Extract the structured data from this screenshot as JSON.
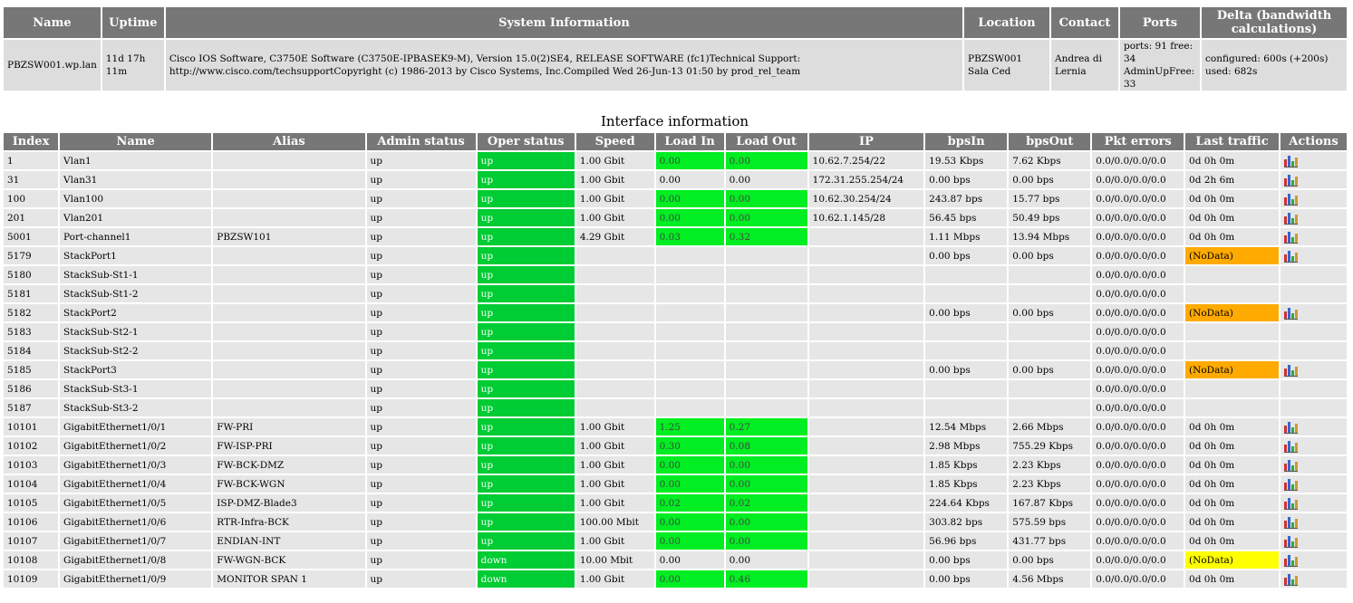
{
  "system": {
    "headers": [
      "Name",
      "Uptime",
      "System Information",
      "Location",
      "Contact",
      "Ports",
      "Delta (bandwidth calculations)"
    ],
    "name": "PBZSW001.wp.lan",
    "uptime": "11d 17h 11m",
    "info": "Cisco IOS Software, C3750E Software (C3750E-IPBASEK9-M), Version 15.0(2)SE4, RELEASE SOFTWARE (fc1)Technical Support: http://www.cisco.com/techsupportCopyright (c) 1986-2013 by Cisco Systems, Inc.Compiled Wed 26-Jun-13 01:50 by prod_rel_team",
    "location": "PBZSW001 Sala Ced",
    "contact": "Andrea di Lernia",
    "ports": "ports: 91 free: 34 AdminUpFree: 33",
    "delta": "configured: 600s (+200s) used: 682s"
  },
  "interfaces": {
    "title": "Interface information",
    "headers": [
      "Index",
      "Name",
      "Alias",
      "Admin status",
      "Oper status",
      "Speed",
      "Load In",
      "Load Out",
      "IP",
      "bpsIn",
      "bpsOut",
      "Pkt errors",
      "Last traffic",
      "Actions"
    ],
    "rows": [
      {
        "index": "1",
        "name": "Vlan1",
        "alias": "",
        "admin": "up",
        "oper": "up",
        "speed": "1.00 Gbit",
        "load_in": "0.00",
        "load_out": "0.00",
        "ip": "10.62.7.254/22",
        "bps_in": "19.53 Kbps",
        "bps_out": "7.62 Kbps",
        "errors": "0.0/0.0/0.0/0.0",
        "last": "0d 0h 0m",
        "last_status": "",
        "load_hl": true,
        "action": true
      },
      {
        "index": "31",
        "name": "Vlan31",
        "alias": "",
        "admin": "up",
        "oper": "up",
        "speed": "1.00 Gbit",
        "load_in": "0.00",
        "load_out": "0.00",
        "ip": "172.31.255.254/24",
        "bps_in": "0.00 bps",
        "bps_out": "0.00 bps",
        "errors": "0.0/0.0/0.0/0.0",
        "last": "0d 2h 6m",
        "last_status": "",
        "load_hl": false,
        "action": true
      },
      {
        "index": "100",
        "name": "Vlan100",
        "alias": "",
        "admin": "up",
        "oper": "up",
        "speed": "1.00 Gbit",
        "load_in": "0.00",
        "load_out": "0.00",
        "ip": "10.62.30.254/24",
        "bps_in": "243.87 bps",
        "bps_out": "15.77 bps",
        "errors": "0.0/0.0/0.0/0.0",
        "last": "0d 0h 0m",
        "last_status": "",
        "load_hl": true,
        "action": true
      },
      {
        "index": "201",
        "name": "Vlan201",
        "alias": "",
        "admin": "up",
        "oper": "up",
        "speed": "1.00 Gbit",
        "load_in": "0.00",
        "load_out": "0.00",
        "ip": "10.62.1.145/28",
        "bps_in": "56.45 bps",
        "bps_out": "50.49 bps",
        "errors": "0.0/0.0/0.0/0.0",
        "last": "0d 0h 0m",
        "last_status": "",
        "load_hl": true,
        "action": true
      },
      {
        "index": "5001",
        "name": "Port-channel1",
        "alias": "PBZSW101",
        "admin": "up",
        "oper": "up",
        "speed": "4.29 Gbit",
        "load_in": "0.03",
        "load_out": "0.32",
        "ip": "",
        "bps_in": "1.11 Mbps",
        "bps_out": "13.94 Mbps",
        "errors": "0.0/0.0/0.0/0.0",
        "last": "0d 0h 0m",
        "last_status": "",
        "load_hl": true,
        "action": true
      },
      {
        "index": "5179",
        "name": "StackPort1",
        "alias": "",
        "admin": "up",
        "oper": "up",
        "speed": "",
        "load_in": "",
        "load_out": "",
        "ip": "",
        "bps_in": "0.00 bps",
        "bps_out": "0.00 bps",
        "errors": "0.0/0.0/0.0/0.0",
        "last": "(NoData)",
        "last_status": "warn",
        "load_hl": false,
        "action": true
      },
      {
        "index": "5180",
        "name": "StackSub-St1-1",
        "alias": "",
        "admin": "up",
        "oper": "up",
        "speed": "",
        "load_in": "",
        "load_out": "",
        "ip": "",
        "bps_in": "",
        "bps_out": "",
        "errors": "0.0/0.0/0.0/0.0",
        "last": "",
        "last_status": "",
        "load_hl": false,
        "action": false
      },
      {
        "index": "5181",
        "name": "StackSub-St1-2",
        "alias": "",
        "admin": "up",
        "oper": "up",
        "speed": "",
        "load_in": "",
        "load_out": "",
        "ip": "",
        "bps_in": "",
        "bps_out": "",
        "errors": "0.0/0.0/0.0/0.0",
        "last": "",
        "last_status": "",
        "load_hl": false,
        "action": false
      },
      {
        "index": "5182",
        "name": "StackPort2",
        "alias": "",
        "admin": "up",
        "oper": "up",
        "speed": "",
        "load_in": "",
        "load_out": "",
        "ip": "",
        "bps_in": "0.00 bps",
        "bps_out": "0.00 bps",
        "errors": "0.0/0.0/0.0/0.0",
        "last": "(NoData)",
        "last_status": "warn",
        "load_hl": false,
        "action": true
      },
      {
        "index": "5183",
        "name": "StackSub-St2-1",
        "alias": "",
        "admin": "up",
        "oper": "up",
        "speed": "",
        "load_in": "",
        "load_out": "",
        "ip": "",
        "bps_in": "",
        "bps_out": "",
        "errors": "0.0/0.0/0.0/0.0",
        "last": "",
        "last_status": "",
        "load_hl": false,
        "action": false
      },
      {
        "index": "5184",
        "name": "StackSub-St2-2",
        "alias": "",
        "admin": "up",
        "oper": "up",
        "speed": "",
        "load_in": "",
        "load_out": "",
        "ip": "",
        "bps_in": "",
        "bps_out": "",
        "errors": "0.0/0.0/0.0/0.0",
        "last": "",
        "last_status": "",
        "load_hl": false,
        "action": false
      },
      {
        "index": "5185",
        "name": "StackPort3",
        "alias": "",
        "admin": "up",
        "oper": "up",
        "speed": "",
        "load_in": "",
        "load_out": "",
        "ip": "",
        "bps_in": "0.00 bps",
        "bps_out": "0.00 bps",
        "errors": "0.0/0.0/0.0/0.0",
        "last": "(NoData)",
        "last_status": "warn",
        "load_hl": false,
        "action": true
      },
      {
        "index": "5186",
        "name": "StackSub-St3-1",
        "alias": "",
        "admin": "up",
        "oper": "up",
        "speed": "",
        "load_in": "",
        "load_out": "",
        "ip": "",
        "bps_in": "",
        "bps_out": "",
        "errors": "0.0/0.0/0.0/0.0",
        "last": "",
        "last_status": "",
        "load_hl": false,
        "action": false
      },
      {
        "index": "5187",
        "name": "StackSub-St3-2",
        "alias": "",
        "admin": "up",
        "oper": "up",
        "speed": "",
        "load_in": "",
        "load_out": "",
        "ip": "",
        "bps_in": "",
        "bps_out": "",
        "errors": "0.0/0.0/0.0/0.0",
        "last": "",
        "last_status": "",
        "load_hl": false,
        "action": false
      },
      {
        "index": "10101",
        "name": "GigabitEthernet1/0/1",
        "alias": "FW-PRI",
        "admin": "up",
        "oper": "up",
        "speed": "1.00 Gbit",
        "load_in": "1.25",
        "load_out": "0.27",
        "ip": "",
        "bps_in": "12.54 Mbps",
        "bps_out": "2.66 Mbps",
        "errors": "0.0/0.0/0.0/0.0",
        "last": "0d 0h 0m",
        "last_status": "",
        "load_hl": true,
        "action": true
      },
      {
        "index": "10102",
        "name": "GigabitEthernet1/0/2",
        "alias": "FW-ISP-PRI",
        "admin": "up",
        "oper": "up",
        "speed": "1.00 Gbit",
        "load_in": "0.30",
        "load_out": "0.08",
        "ip": "",
        "bps_in": "2.98 Mbps",
        "bps_out": "755.29 Kbps",
        "errors": "0.0/0.0/0.0/0.0",
        "last": "0d 0h 0m",
        "last_status": "",
        "load_hl": true,
        "action": true
      },
      {
        "index": "10103",
        "name": "GigabitEthernet1/0/3",
        "alias": "FW-BCK-DMZ",
        "admin": "up",
        "oper": "up",
        "speed": "1.00 Gbit",
        "load_in": "0.00",
        "load_out": "0.00",
        "ip": "",
        "bps_in": "1.85 Kbps",
        "bps_out": "2.23 Kbps",
        "errors": "0.0/0.0/0.0/0.0",
        "last": "0d 0h 0m",
        "last_status": "",
        "load_hl": true,
        "action": true
      },
      {
        "index": "10104",
        "name": "GigabitEthernet1/0/4",
        "alias": "FW-BCK-WGN",
        "admin": "up",
        "oper": "up",
        "speed": "1.00 Gbit",
        "load_in": "0.00",
        "load_out": "0.00",
        "ip": "",
        "bps_in": "1.85 Kbps",
        "bps_out": "2.23 Kbps",
        "errors": "0.0/0.0/0.0/0.0",
        "last": "0d 0h 0m",
        "last_status": "",
        "load_hl": true,
        "action": true
      },
      {
        "index": "10105",
        "name": "GigabitEthernet1/0/5",
        "alias": "ISP-DMZ-Blade3",
        "admin": "up",
        "oper": "up",
        "speed": "1.00 Gbit",
        "load_in": "0.02",
        "load_out": "0.02",
        "ip": "",
        "bps_in": "224.64 Kbps",
        "bps_out": "167.87 Kbps",
        "errors": "0.0/0.0/0.0/0.0",
        "last": "0d 0h 0m",
        "last_status": "",
        "load_hl": true,
        "action": true
      },
      {
        "index": "10106",
        "name": "GigabitEthernet1/0/6",
        "alias": "RTR-Infra-BCK",
        "admin": "up",
        "oper": "up",
        "speed": "100.00 Mbit",
        "load_in": "0.00",
        "load_out": "0.00",
        "ip": "",
        "bps_in": "303.82 bps",
        "bps_out": "575.59 bps",
        "errors": "0.0/0.0/0.0/0.0",
        "last": "0d 0h 0m",
        "last_status": "",
        "load_hl": true,
        "action": true
      },
      {
        "index": "10107",
        "name": "GigabitEthernet1/0/7",
        "alias": "ENDIAN-INT",
        "admin": "up",
        "oper": "up",
        "speed": "1.00 Gbit",
        "load_in": "0.00",
        "load_out": "0.00",
        "ip": "",
        "bps_in": "56.96 bps",
        "bps_out": "431.77 bps",
        "errors": "0.0/0.0/0.0/0.0",
        "last": "0d 0h 0m",
        "last_status": "",
        "load_hl": true,
        "action": true
      },
      {
        "index": "10108",
        "name": "GigabitEthernet1/0/8",
        "alias": "FW-WGN-BCK",
        "admin": "up",
        "oper": "down",
        "speed": "10.00 Mbit",
        "load_in": "0.00",
        "load_out": "0.00",
        "ip": "",
        "bps_in": "0.00 bps",
        "bps_out": "0.00 bps",
        "errors": "0.0/0.0/0.0/0.0",
        "last": "(NoData)",
        "last_status": "idle",
        "load_hl": false,
        "action": true
      },
      {
        "index": "10109",
        "name": "GigabitEthernet1/0/9",
        "alias": "MONITOR SPAN 1",
        "admin": "up",
        "oper": "down",
        "speed": "1.00 Gbit",
        "load_in": "0.00",
        "load_out": "0.46",
        "ip": "",
        "bps_in": "0.00 bps",
        "bps_out": "4.56 Mbps",
        "errors": "0.0/0.0/0.0/0.0",
        "last": "0d 0h 0m",
        "last_status": "",
        "load_hl": true,
        "action": true
      }
    ]
  },
  "colors": {
    "header_bg": "#777777",
    "cell_bg": "#e6e6e6",
    "oper_status": "#00cc33",
    "load": "#00ee22",
    "nodata_warn": "#ffaa00",
    "nodata_idle": "#ffff00"
  },
  "icons": {
    "action": "bar-chart-icon"
  }
}
